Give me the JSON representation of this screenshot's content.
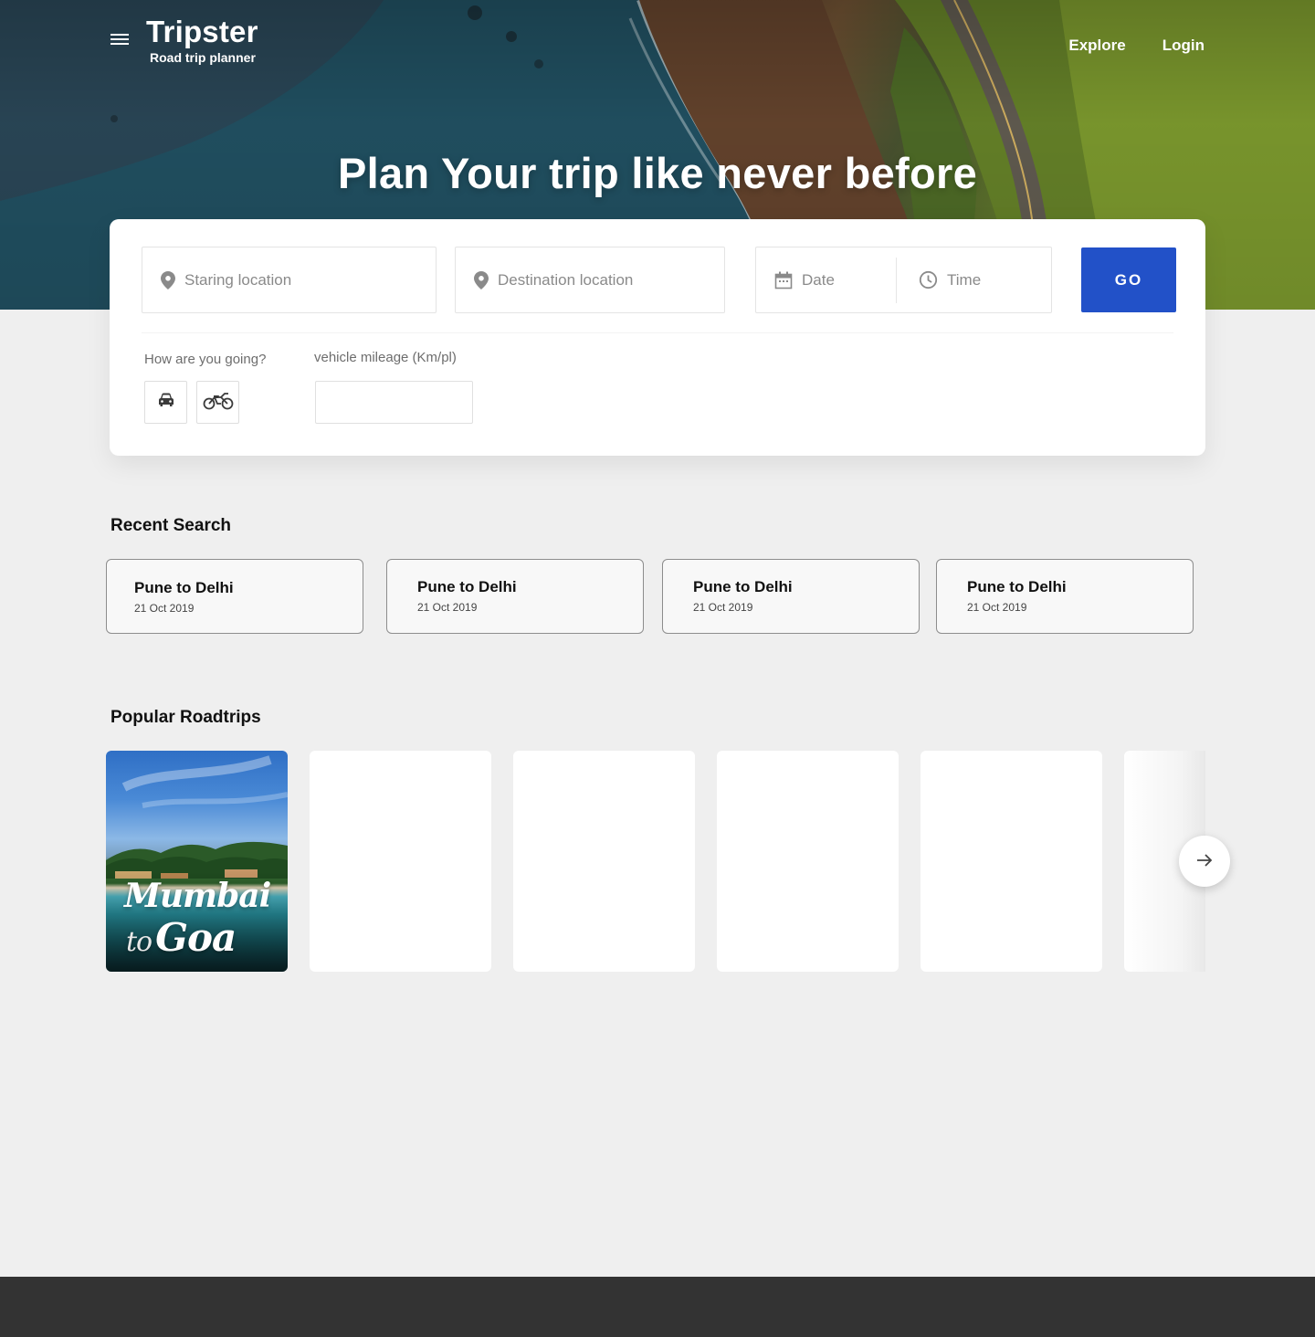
{
  "brand": {
    "title": "Tripster",
    "subtitle": "Road trip planner"
  },
  "nav": {
    "links": [
      {
        "label": "Explore"
      },
      {
        "label": "Login"
      }
    ]
  },
  "hero": {
    "headline": "Plan Your trip like never before"
  },
  "search": {
    "start_placeholder": "Staring location",
    "destination_placeholder": "Destination location",
    "date_label": "Date",
    "time_label": "Time",
    "go_label": "GO",
    "mode_label": "How are you going?",
    "modes": [
      {
        "icon": "car-icon"
      },
      {
        "icon": "motorbike-icon"
      }
    ],
    "mileage_label": "vehicle mileage (Km/pl)",
    "mileage_value": ""
  },
  "recent": {
    "title": "Recent Search",
    "items": [
      {
        "route": "Pune to Delhi",
        "date": "21 Oct 2019"
      },
      {
        "route": "Pune to Delhi",
        "date": "21 Oct 2019"
      },
      {
        "route": "Pune to Delhi",
        "date": "21 Oct 2019"
      },
      {
        "route": "Pune to Delhi",
        "date": "21 Oct 2019"
      }
    ]
  },
  "popular": {
    "title": "Popular Roadtrips",
    "featured": {
      "line1": "Mumbai",
      "connector": "to",
      "line2": "Goa"
    }
  },
  "colors": {
    "accent": "#2251c8",
    "footer": "#333333",
    "page_bg": "#efefef"
  }
}
